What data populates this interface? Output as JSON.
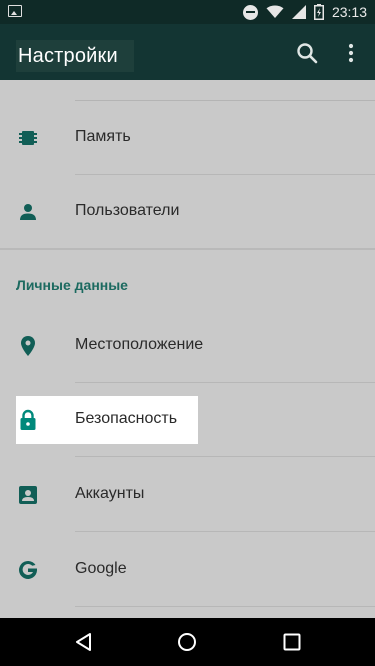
{
  "status_bar": {
    "time": "23:13",
    "icons": [
      "image-icon",
      "do-not-disturb-icon",
      "wifi-icon",
      "signal-icon",
      "battery-icon"
    ]
  },
  "toolbar": {
    "title": "Настройки",
    "actions": [
      "search-icon",
      "more-vert-icon"
    ]
  },
  "items": [
    {
      "label": "Память",
      "icon": "memory-chip-icon"
    },
    {
      "label": "Пользователи",
      "icon": "person-icon"
    }
  ],
  "section": {
    "header": "Личные данные",
    "items": [
      {
        "label": "Местоположение",
        "icon": "location-pin-icon"
      },
      {
        "label": "Безопасность",
        "icon": "lock-icon",
        "highlighted": true
      },
      {
        "label": "Аккаунты",
        "icon": "account-box-icon"
      },
      {
        "label": "Google",
        "icon": "google-g-icon"
      }
    ]
  },
  "navigation_bar": [
    "back-icon",
    "home-icon",
    "recents-icon"
  ],
  "colors": {
    "accent": "#00897b",
    "toolbar": "#133533",
    "status_bar": "#0f2a27",
    "dimmed_background": "#c9c9c9",
    "section_header": "#1c6a60"
  }
}
